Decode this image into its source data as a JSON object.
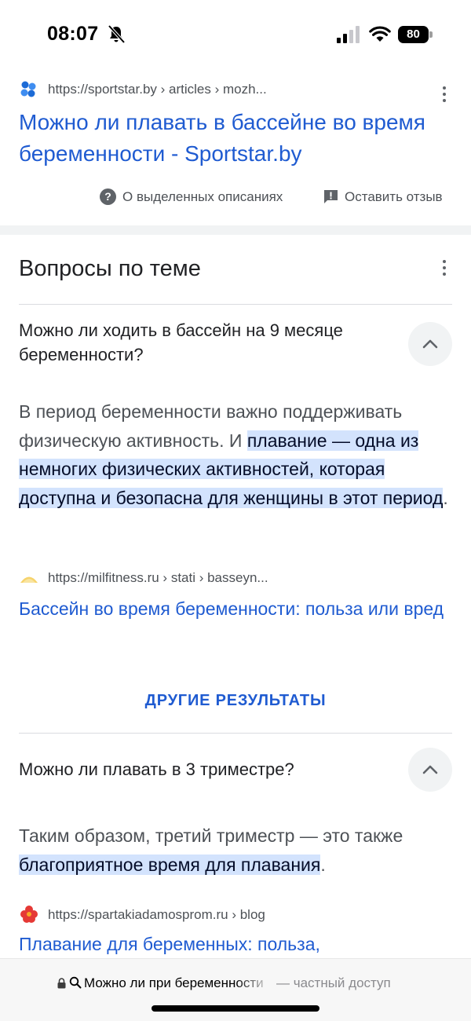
{
  "status_bar": {
    "time": "08:07",
    "battery": "80",
    "icons": [
      "bell-slash-icon",
      "cellular-signal-icon",
      "wifi-icon",
      "battery-icon"
    ]
  },
  "result": {
    "url": "https://sportstar.by › articles › mozh...",
    "title": "Можно ли плавать в бассейне во время беременности - Sportstar.by",
    "about_label": "О выделенных описаниях",
    "feedback_label": "Оставить отзыв"
  },
  "questions": {
    "title": "Вопросы по теме",
    "items": [
      {
        "question": "Можно ли ходить в бассейн на 9 месяце беременности?",
        "answer_plain": "В период беременности важно поддерживать физическую активность. И ",
        "answer_highlight": "плавание — одна из немногих физических активностей, которая доступна и безопасна для женщины в этот период",
        "answer_tail": ".",
        "source_url": "https://milfitness.ru › stati › basseyn...",
        "source_title": "Бассейн во время беременности: польза или вред"
      },
      {
        "question": "Можно ли плавать в 3 триместре?",
        "answer_plain": "Таким образом, третий триместр — это также ",
        "answer_highlight": "благоприятное время для плавания",
        "answer_tail": ".",
        "source_url": "https://spartakiadamosprom.ru › blog",
        "source_title": "Плавание для беременных: польза,"
      }
    ],
    "more_results": "ДРУГИЕ РЕЗУЛЬТАТЫ"
  },
  "bottom_bar": {
    "query": "Можно ли при беременности",
    "private": "— частный доступ"
  },
  "colors": {
    "link": "#1f5bd1",
    "highlight": "#d3e3fd",
    "text": "#202124",
    "muted": "#4d5156"
  }
}
